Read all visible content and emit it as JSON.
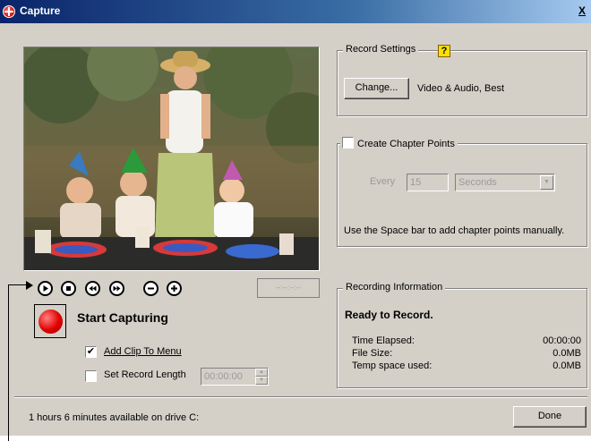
{
  "window": {
    "title": "Capture",
    "close_glyph": "X"
  },
  "video": {
    "preview": "video-preview"
  },
  "transport": {
    "timecode": "--:--:--:--",
    "buttons": [
      "play-icon",
      "stop-icon",
      "rewind-icon",
      "fast-forward-icon",
      "zoom-out-icon",
      "zoom-in-icon"
    ]
  },
  "capture": {
    "start_label": "Start Capturing",
    "add_clip_checked": true,
    "add_clip_check": "✔",
    "add_clip_label": "Add Clip To Menu",
    "record_length_checked": false,
    "record_length_label": "Set Record Length",
    "record_length_value": "00:00:00"
  },
  "record_settings": {
    "title": "Record Settings",
    "change_button": "Change...",
    "value": "Video & Audio, Best",
    "help_glyph": "?"
  },
  "chapter_points": {
    "checked": false,
    "title": "Create Chapter Points",
    "every_label": "Every",
    "interval": "15",
    "unit": "Seconds",
    "note": "Use the Space bar to add chapter points manually."
  },
  "recording_info": {
    "title": "Recording Information",
    "status": "Ready to Record.",
    "rows": [
      {
        "label": "Time Elapsed:",
        "value": "00:00:00"
      },
      {
        "label": "File Size:",
        "value": "0.0MB"
      },
      {
        "label": "Temp space used:",
        "value": "0.0MB"
      }
    ]
  },
  "footer": {
    "available": "1 hours 6 minutes available on drive C:",
    "done_button": "Done"
  }
}
